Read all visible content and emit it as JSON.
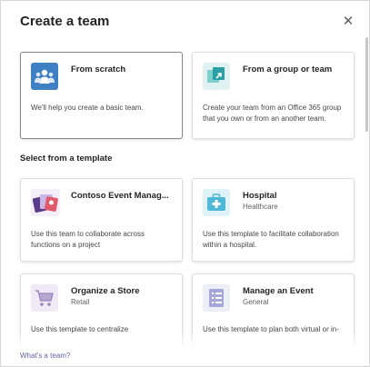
{
  "dialog": {
    "title": "Create a team",
    "close_label": "✕"
  },
  "create_options": [
    {
      "title": "From scratch",
      "description": "We'll help you create a basic team.",
      "icon": "people-icon",
      "icon_color": "#3f7fc3"
    },
    {
      "title": "From a group or team",
      "description": "Create your team from an Office 365 group that you own or from an another team.",
      "icon": "group-team-icon",
      "icon_color": "#2aa0a4"
    }
  ],
  "templates_section": {
    "label": "Select from a template"
  },
  "templates": [
    {
      "title": "Contoso Event Manag...",
      "subtitle": "",
      "description": "Use this team to collaborate across functions on a project",
      "icon": "event-cards-icon",
      "icon_color": "#7b5ea7"
    },
    {
      "title": "Hospital",
      "subtitle": "Healthcare",
      "description": "Use this template to facilitate collaboration within a hospital.",
      "icon": "medical-kit-icon",
      "icon_color": "#4fb7d8"
    },
    {
      "title": "Organize a Store",
      "subtitle": "Retail",
      "description": "Use this template to centralize",
      "icon": "shopping-cart-icon",
      "icon_color": "#b6a7cf"
    },
    {
      "title": "Manage an Event",
      "subtitle": "General",
      "description": "Use this template to plan both virtual or in-",
      "icon": "event-list-icon",
      "icon_color": "#a5a8d6"
    }
  ],
  "footer": {
    "link": "What's a team?"
  }
}
